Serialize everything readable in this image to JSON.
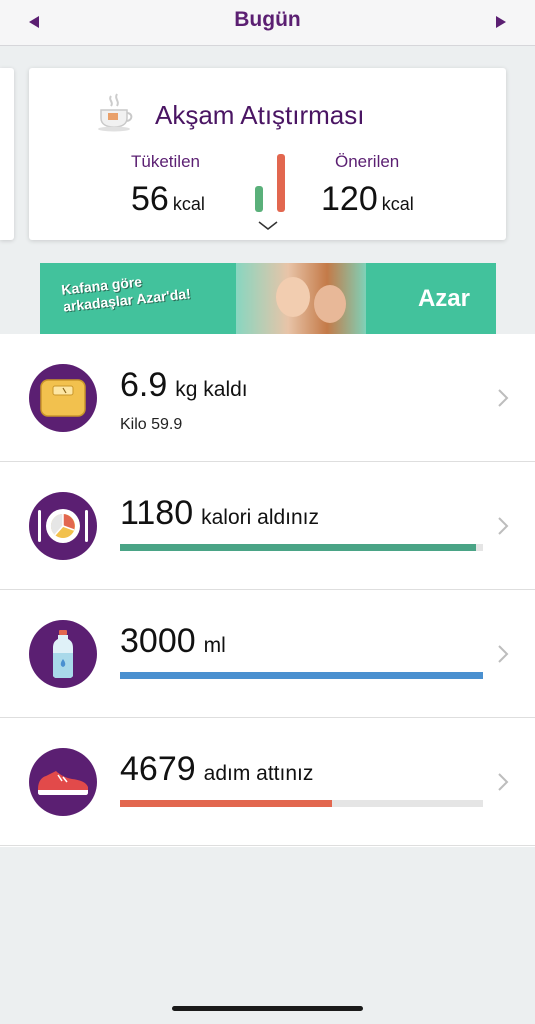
{
  "header": {
    "title": "Bugün",
    "prev_icon": "triangle-left-icon",
    "next_icon": "triangle-right-icon"
  },
  "meal_card": {
    "icon": "tea-cup-icon",
    "title": "Akşam Atıştırması",
    "consumed_label": "Tüketilen",
    "consumed_value": "56",
    "recommended_label": "Önerilen",
    "recommended_value": "120",
    "unit": "kcal"
  },
  "ad": {
    "text_line1": "Kafana göre",
    "text_line2": "arkadaşlar Azar'da!",
    "brand": "Azar"
  },
  "stats": {
    "weight": {
      "icon": "scale-icon",
      "value": "6.9",
      "suffix": "kg kaldı",
      "sub": "Kilo 59.9"
    },
    "calories": {
      "icon": "plate-icon",
      "value": "1180",
      "suffix": "kalori aldınız",
      "progress": 0.98
    },
    "water": {
      "icon": "water-bottle-icon",
      "value": "3000",
      "suffix": "ml",
      "progress": 1.0
    },
    "steps": {
      "icon": "sneaker-icon",
      "value": "4679",
      "suffix": "adım attınız",
      "progress": 0.585
    }
  },
  "colors": {
    "brand_purple": "#5b1f72",
    "green": "#4aa486",
    "blue": "#4a90d0",
    "red": "#e2674f"
  }
}
